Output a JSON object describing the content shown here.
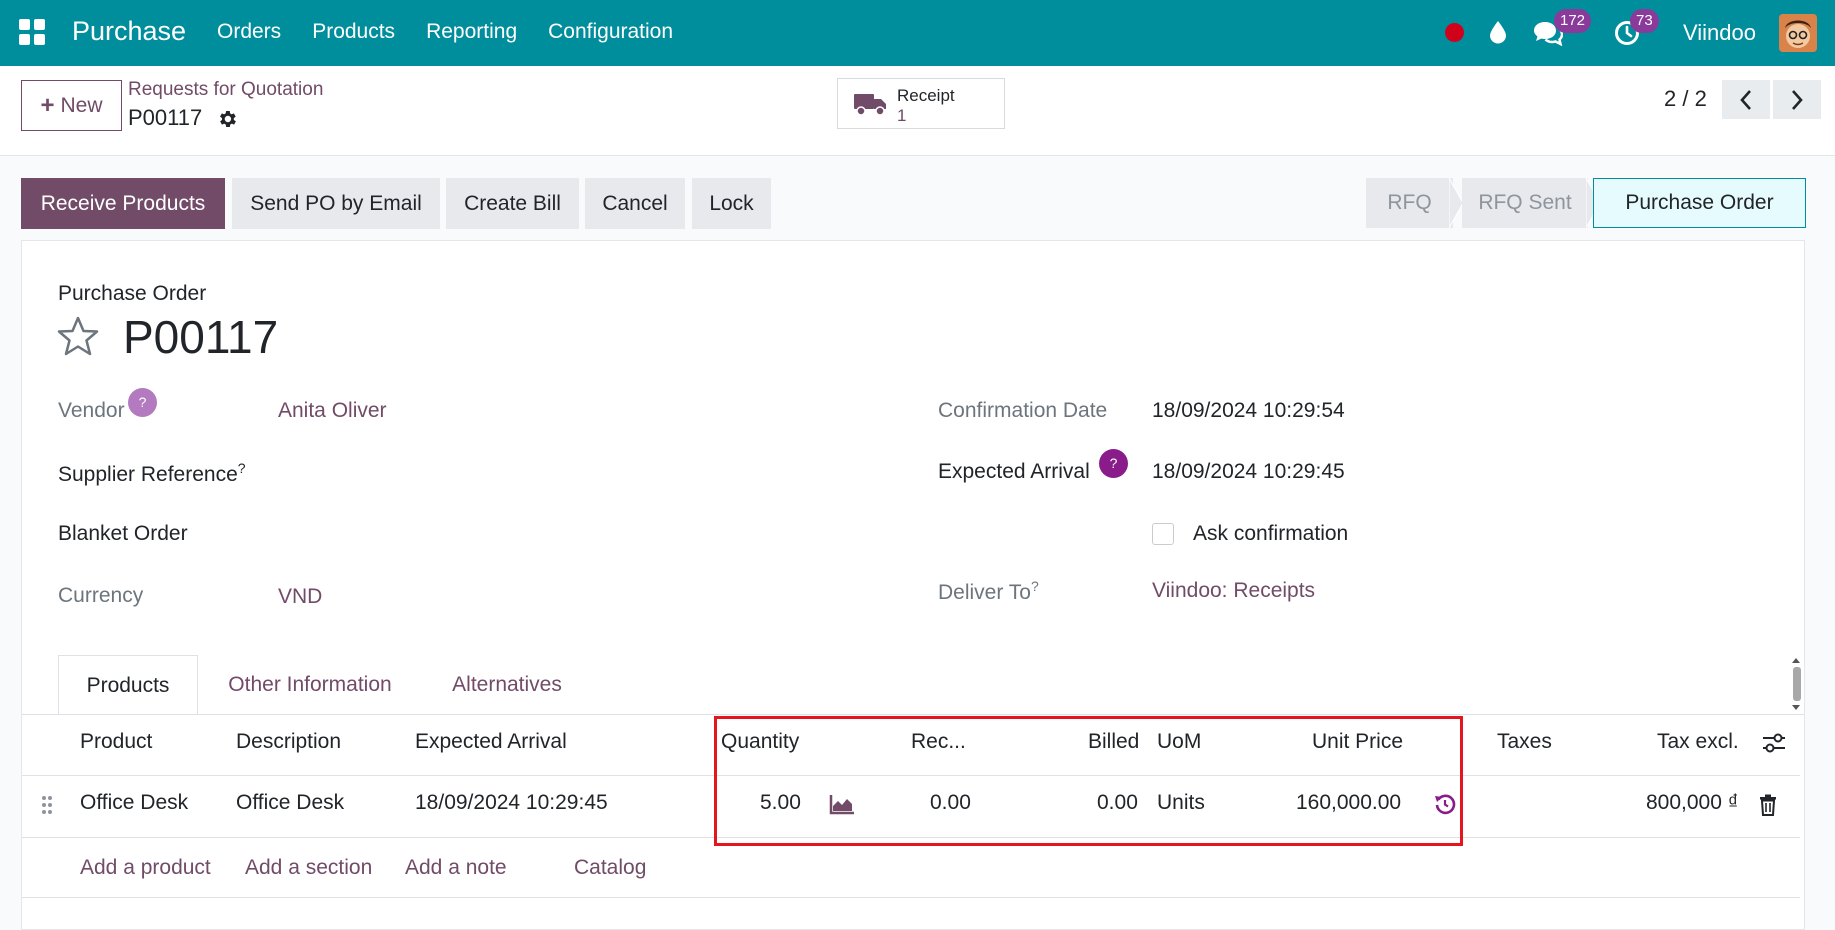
{
  "navbar": {
    "app_name": "Purchase",
    "menu": [
      "Orders",
      "Products",
      "Reporting",
      "Configuration"
    ],
    "messages_count": "172",
    "activities_count": "73",
    "company": "Viindoo"
  },
  "control": {
    "new_label": "New",
    "breadcrumb": "Requests for Quotation",
    "record_name": "P00117",
    "receipt_label": "Receipt",
    "receipt_count": "1",
    "pager": "2 / 2"
  },
  "actions": {
    "receive": "Receive Products",
    "send_email": "Send PO by Email",
    "create_bill": "Create Bill",
    "cancel": "Cancel",
    "lock": "Lock"
  },
  "stages": [
    "RFQ",
    "RFQ Sent",
    "Purchase Order"
  ],
  "form": {
    "doc_type": "Purchase Order",
    "title": "P00117",
    "vendor_label": "Vendor",
    "vendor_value": "Anita Oliver",
    "supplier_ref_label": "Supplier Reference",
    "blanket_label": "Blanket Order",
    "currency_label": "Currency",
    "currency_value": "VND",
    "confirm_date_label": "Confirmation Date",
    "confirm_date_value": "18/09/2024 10:29:54",
    "expected_label": "Expected Arrival",
    "expected_value": "18/09/2024 10:29:45",
    "ask_confirm_label": "Ask confirmation",
    "deliver_label": "Deliver To",
    "deliver_value": "Viindoo: Receipts",
    "help_mark": "?"
  },
  "tabs": [
    "Products",
    "Other Information",
    "Alternatives"
  ],
  "table": {
    "headers": {
      "product": "Product",
      "description": "Description",
      "expected": "Expected Arrival",
      "quantity": "Quantity",
      "received": "Rec...",
      "billed": "Billed",
      "uom": "UoM",
      "unit_price": "Unit Price",
      "taxes": "Taxes",
      "tax_excl": "Tax excl."
    },
    "rows": [
      {
        "product": "Office Desk",
        "description": "Office Desk",
        "expected": "18/09/2024 10:29:45",
        "quantity": "5.00",
        "received": "0.00",
        "billed": "0.00",
        "uom": "Units",
        "unit_price": "160,000.00",
        "taxes": "",
        "tax_excl": "800,000 ₫"
      }
    ],
    "add_product": "Add a product",
    "add_section": "Add a section",
    "add_note": "Add a note",
    "catalog": "Catalog"
  },
  "colors": {
    "navbar": "#018e9c",
    "primary": "#714b67",
    "highlight": "#e4151c"
  }
}
